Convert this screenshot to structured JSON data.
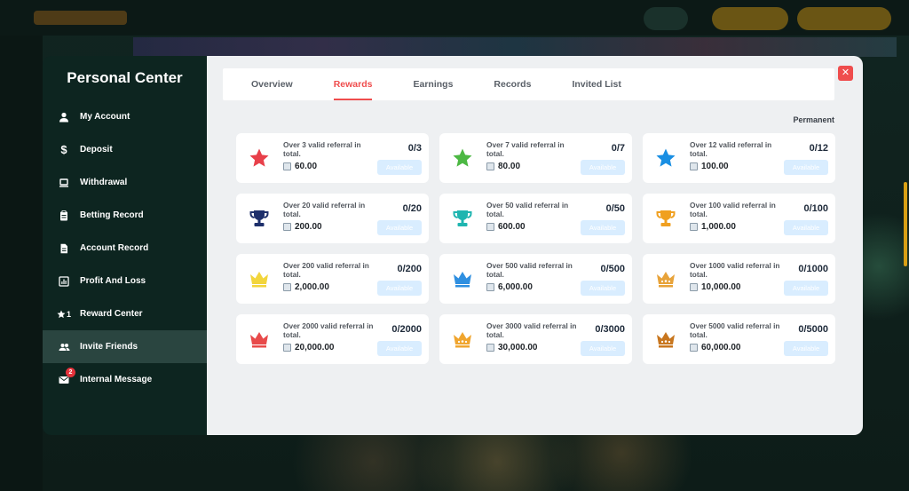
{
  "menu": {
    "title": "Personal Center",
    "items": [
      {
        "label": "My Account",
        "icon": "user-icon"
      },
      {
        "label": "Deposit",
        "icon": "dollar-icon"
      },
      {
        "label": "Withdrawal",
        "icon": "laptop-icon"
      },
      {
        "label": "Betting Record",
        "icon": "clipboard-icon"
      },
      {
        "label": "Account Record",
        "icon": "document-icon"
      },
      {
        "label": "Profit And Loss",
        "icon": "chart-icon"
      },
      {
        "label": "Reward Center",
        "icon": "star-icon",
        "badge": "1"
      },
      {
        "label": "Invite Friends",
        "icon": "people-icon",
        "active": true
      },
      {
        "label": "Internal Message",
        "icon": "mail-icon",
        "badge": "2"
      }
    ]
  },
  "tabs": [
    "Overview",
    "Rewards",
    "Earnings",
    "Records",
    "Invited List"
  ],
  "active_tab": "Rewards",
  "section_label": "Permanent",
  "button_label": "Available",
  "rewards": [
    {
      "text": "Over 3 valid referral in total.",
      "amount": "60.00",
      "progress": "0/3",
      "icon": "star",
      "color": "#e8404a"
    },
    {
      "text": "Over 7 valid referral in total.",
      "amount": "80.00",
      "progress": "0/7",
      "icon": "star",
      "color": "#4cb843"
    },
    {
      "text": "Over 12 valid referral in total.",
      "amount": "100.00",
      "progress": "0/12",
      "icon": "star",
      "color": "#1a8fe3"
    },
    {
      "text": "Over 20 valid referral in total.",
      "amount": "200.00",
      "progress": "0/20",
      "icon": "trophy",
      "color": "#1d2f6b"
    },
    {
      "text": "Over 50 valid referral in total.",
      "amount": "600.00",
      "progress": "0/50",
      "icon": "trophy",
      "color": "#1fb5b0"
    },
    {
      "text": "Over 100 valid referral in total.",
      "amount": "1,000.00",
      "progress": "0/100",
      "icon": "trophy",
      "color": "#f0a020"
    },
    {
      "text": "Over 200 valid referral in total.",
      "amount": "2,000.00",
      "progress": "0/200",
      "icon": "crown",
      "color": "#f2d53c"
    },
    {
      "text": "Over 500 valid referral in total.",
      "amount": "6,000.00",
      "progress": "0/500",
      "icon": "crown",
      "color": "#2f8fe0"
    },
    {
      "text": "Over 1000 valid referral in total.",
      "amount": "10,000.00",
      "progress": "0/1000",
      "icon": "crown-jeweled",
      "color": "#e8a33a"
    },
    {
      "text": "Over 2000 valid referral in total.",
      "amount": "20,000.00",
      "progress": "0/2000",
      "icon": "crown",
      "color": "#e84a4a"
    },
    {
      "text": "Over 3000 valid referral in total.",
      "amount": "30,000.00",
      "progress": "0/3000",
      "icon": "crown-jeweled",
      "color": "#f0a52e"
    },
    {
      "text": "Over 5000 valid referral in total.",
      "amount": "60,000.00",
      "progress": "0/5000",
      "icon": "crown-jeweled",
      "color": "#c8761e"
    }
  ]
}
